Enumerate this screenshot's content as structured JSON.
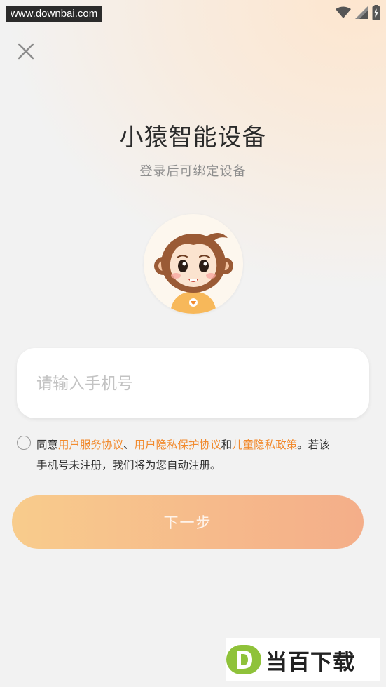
{
  "status_bar": {
    "watermark": "www.downbai.com",
    "icons": [
      "wifi-icon",
      "signal-icon",
      "battery-charging-icon"
    ]
  },
  "header": {
    "close_icon": "close-icon",
    "title": "小猿智能设备",
    "subtitle": "登录后可绑定设备"
  },
  "avatar": {
    "name": "monkey-mascot"
  },
  "form": {
    "phone_placeholder": "请输入手机号",
    "phone_value": ""
  },
  "agreement": {
    "checked": false,
    "prefix": "同意",
    "link1": "用户服务协议",
    "sep1": "、",
    "link2": "用户隐私保护协议",
    "sep2": "和",
    "link3": "儿童隐私政策",
    "suffix_line1": "。若该",
    "line2": "手机号未注册，我们将为您自动注册。"
  },
  "actions": {
    "next_label": "下一步"
  },
  "logo": {
    "text": "当百下载"
  },
  "colors": {
    "link": "#f28a2d",
    "button_start": "#f8cc8c",
    "button_end": "#f4ae89",
    "logo_green": "#8fc23a"
  }
}
